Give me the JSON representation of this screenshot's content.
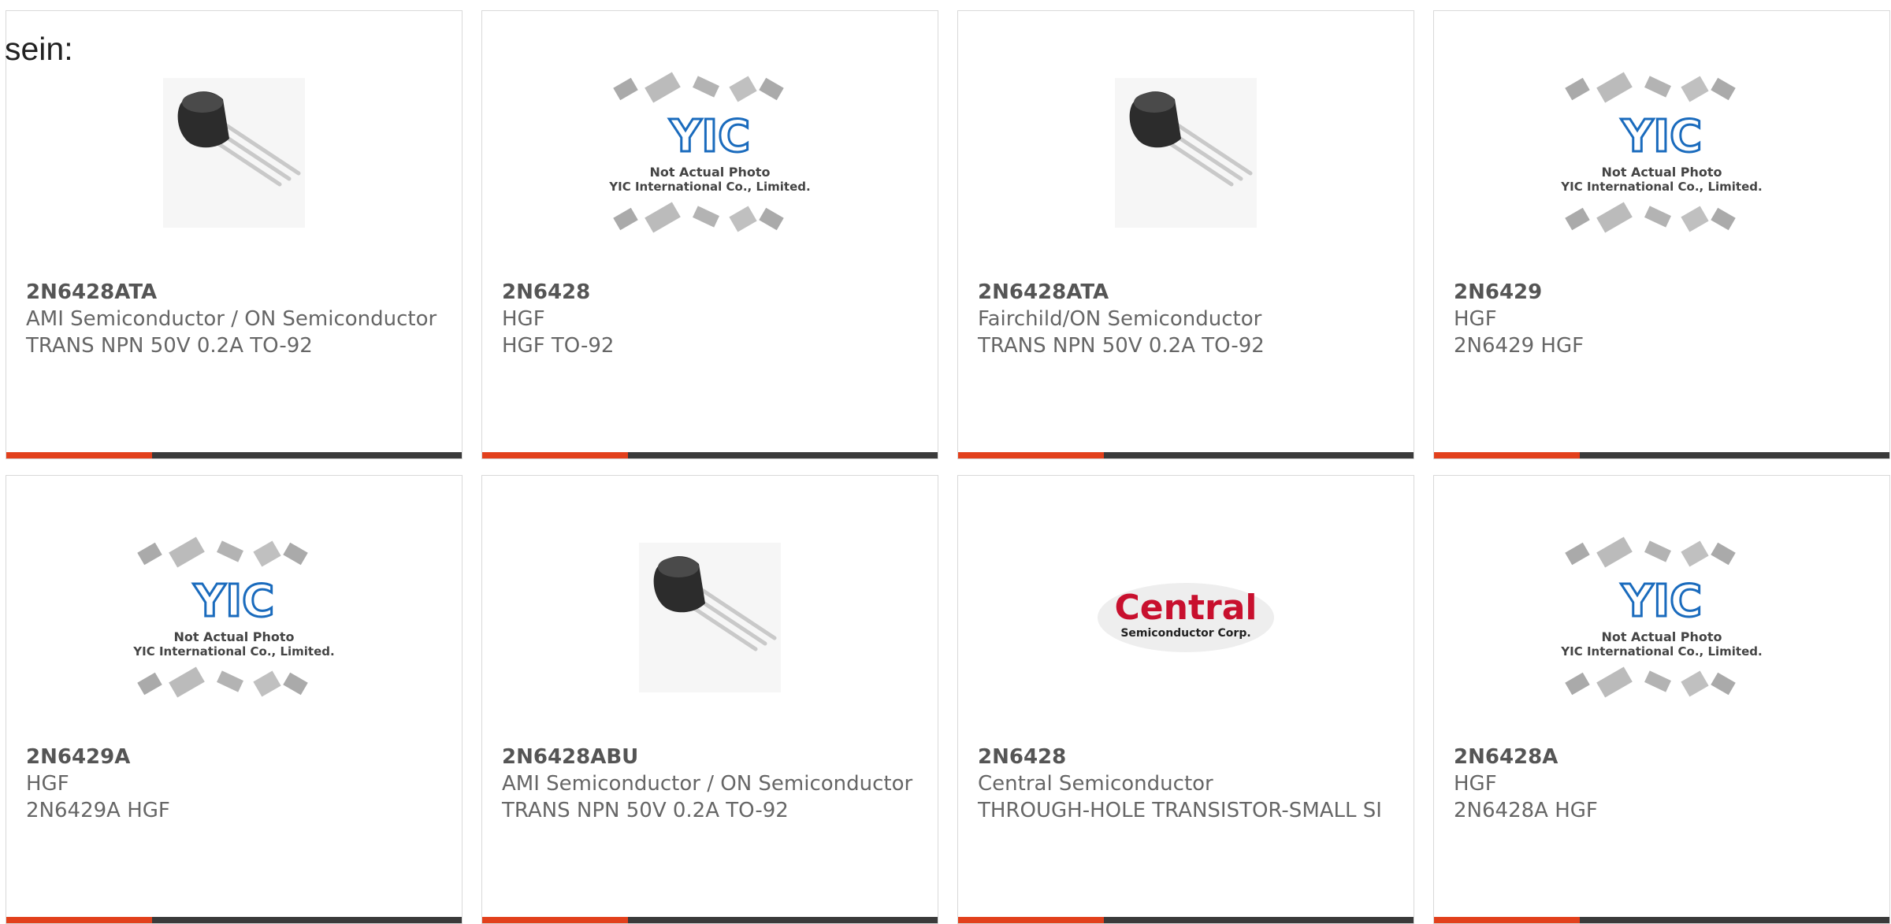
{
  "intro_text": "sein:",
  "products": [
    {
      "part": "2N6428ATA",
      "manufacturer": "AMI Semiconductor / ON Semiconductor",
      "description": "TRANS NPN 50V 0.2A TO-92",
      "image": "transistor-to92"
    },
    {
      "part": "2N6428",
      "manufacturer": "HGF",
      "description": "HGF TO-92",
      "image": "yic-placeholder"
    },
    {
      "part": "2N6428ATA",
      "manufacturer": "Fairchild/ON Semiconductor",
      "description": "TRANS NPN 50V 0.2A TO-92",
      "image": "transistor-to92"
    },
    {
      "part": "2N6429",
      "manufacturer": "HGF",
      "description": "2N6429 HGF",
      "image": "yic-placeholder"
    },
    {
      "part": "2N6429A",
      "manufacturer": "HGF",
      "description": "2N6429A HGF",
      "image": "yic-placeholder"
    },
    {
      "part": "2N6428ABU",
      "manufacturer": "AMI Semiconductor / ON Semiconductor",
      "description": "TRANS NPN 50V 0.2A TO-92",
      "image": "transistor-to92"
    },
    {
      "part": "2N6428",
      "manufacturer": "Central Semiconductor",
      "description": "THROUGH-HOLE TRANSISTOR-SMALL SI",
      "image": "central-logo"
    },
    {
      "part": "2N6428A",
      "manufacturer": "HGF",
      "description": "2N6428A HGF",
      "image": "yic-placeholder"
    }
  ],
  "placeholder": {
    "caption_line1": "Not Actual Photo",
    "caption_line2": "YIC International Co., Limited.",
    "logo_text": "YIC"
  },
  "central_logo": {
    "name": "Central",
    "tagline": "Semiconductor Corp."
  },
  "colors": {
    "accent": "#e2401c",
    "bar": "#3a3a3a",
    "yic_blue": "#1a6bbd",
    "central_red": "#c8102e"
  }
}
